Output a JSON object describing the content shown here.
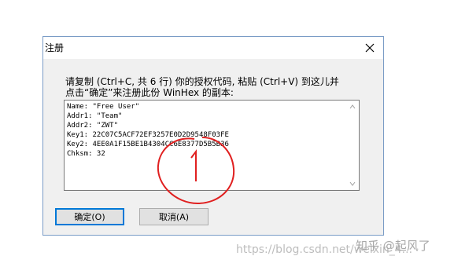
{
  "dialog": {
    "title": "注册",
    "instructions_line1": "请复制 (Ctrl+C, 共 6 行) 你的授权代码, 粘贴 (Ctrl+V) 到这儿并",
    "instructions_line2": "点击“确定”来注册此份 WinHex 的副本:",
    "code_lines": [
      "Name: \"Free User\"",
      "Addr1: \"Team\"",
      "Addr2: \"ZWT\"",
      "Key1: 22C07C5ACF72EF3257E0D2D9548F03FE",
      "Key2: 4EE0A1F15BE1B4304CC6E8377D5B5B36",
      "Chksm: 32"
    ],
    "ok_label": "确定(O)",
    "cancel_label": "取消(A)"
  },
  "watermark": {
    "url": "https://blog.csdn.net/weixin_4...",
    "zhihu": "知乎 @起风了"
  },
  "icons": {
    "close": "close-icon",
    "scroll_up": "chevron-up-icon",
    "scroll_down": "chevron-down-icon"
  },
  "colors": {
    "dialog_border": "#7a9cc6",
    "default_button_border": "#0078d7",
    "annotation_red": "#e02020"
  }
}
